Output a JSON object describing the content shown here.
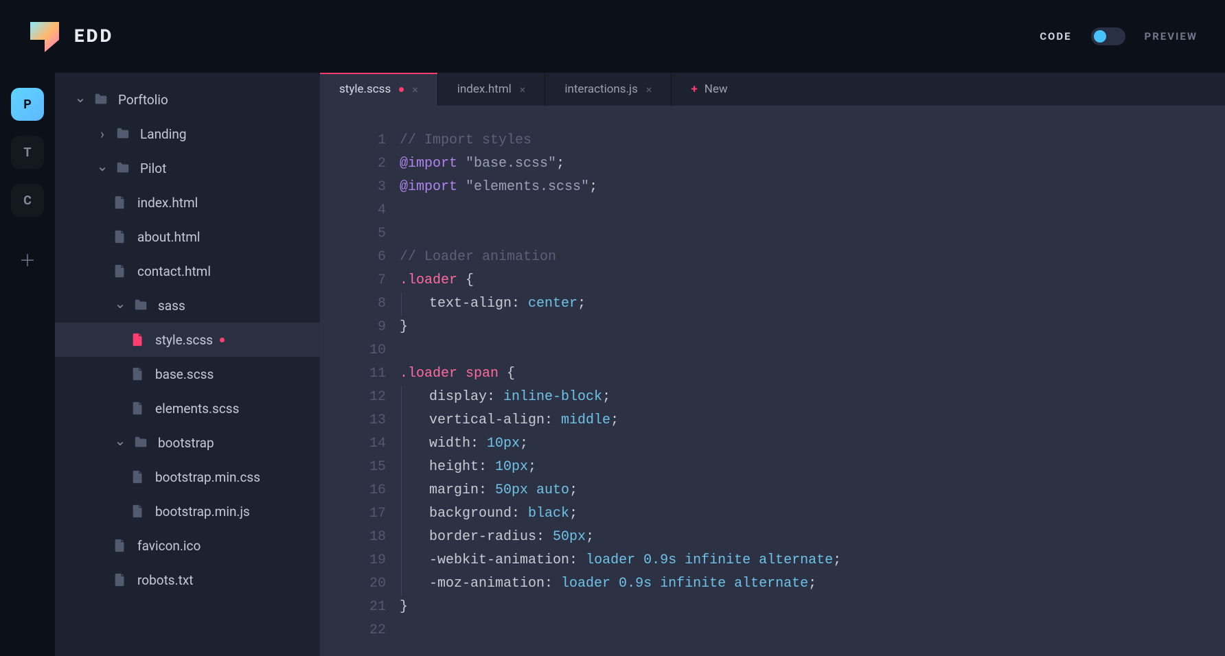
{
  "header": {
    "app_name": "EDD",
    "code_label": "CODE",
    "preview_label": "PREVIEW",
    "mode": "code"
  },
  "rail": {
    "items": [
      {
        "letter": "P",
        "active": true
      },
      {
        "letter": "T",
        "active": false
      },
      {
        "letter": "C",
        "active": false
      }
    ]
  },
  "sidebar": {
    "tree": [
      {
        "name": "Porftolio",
        "type": "folder",
        "level": 1,
        "expanded": true
      },
      {
        "name": "Landing",
        "type": "folder",
        "level": 2,
        "expanded": false
      },
      {
        "name": "Pilot",
        "type": "folder",
        "level": 2,
        "expanded": true
      },
      {
        "name": "index.html",
        "type": "file",
        "level": 3
      },
      {
        "name": "about.html",
        "type": "file",
        "level": 3
      },
      {
        "name": "contact.html",
        "type": "file",
        "level": 3
      },
      {
        "name": "sass",
        "type": "folder",
        "level": 3,
        "expanded": true
      },
      {
        "name": "style.scss",
        "type": "file",
        "level": 4,
        "active": true,
        "modified": true
      },
      {
        "name": "base.scss",
        "type": "file",
        "level": 4
      },
      {
        "name": "elements.scss",
        "type": "file",
        "level": 4
      },
      {
        "name": "bootstrap",
        "type": "folder",
        "level": 3,
        "expanded": true
      },
      {
        "name": "bootstrap.min.css",
        "type": "file",
        "level": 4
      },
      {
        "name": "bootstrap.min.js",
        "type": "file",
        "level": 4
      },
      {
        "name": "favicon.ico",
        "type": "file",
        "level": 3
      },
      {
        "name": "robots.txt",
        "type": "file",
        "level": 3
      }
    ]
  },
  "tabs": {
    "items": [
      {
        "label": "style.scss",
        "active": true,
        "modified": true
      },
      {
        "label": "index.html",
        "active": false
      },
      {
        "label": "interactions.js",
        "active": false
      }
    ],
    "new_label": "New"
  },
  "code": {
    "lines": [
      {
        "n": 1,
        "t": "comment",
        "text": "// Import styles"
      },
      {
        "n": 2,
        "t": "import",
        "kw": "@import",
        "str": "\"base.scss\""
      },
      {
        "n": 3,
        "t": "import",
        "kw": "@import",
        "str": "\"elements.scss\""
      },
      {
        "n": 4,
        "t": "blank"
      },
      {
        "n": 5,
        "t": "blank"
      },
      {
        "n": 6,
        "t": "comment",
        "text": "// Loader animation"
      },
      {
        "n": 7,
        "t": "selopen",
        "sel": ".loader"
      },
      {
        "n": 8,
        "t": "prop",
        "prop": "text-align",
        "val": "center"
      },
      {
        "n": 9,
        "t": "close"
      },
      {
        "n": 10,
        "t": "blank"
      },
      {
        "n": 11,
        "t": "selopen",
        "sel": ".loader span"
      },
      {
        "n": 12,
        "t": "prop",
        "prop": "display",
        "val": "inline-block"
      },
      {
        "n": 13,
        "t": "prop",
        "prop": "vertical-align",
        "val": "middle"
      },
      {
        "n": 14,
        "t": "prop",
        "prop": "width",
        "val": "10px"
      },
      {
        "n": 15,
        "t": "prop",
        "prop": "height",
        "val": "10px"
      },
      {
        "n": 16,
        "t": "prop",
        "prop": "margin",
        "val": "50px auto"
      },
      {
        "n": 17,
        "t": "prop",
        "prop": "background",
        "val": "black"
      },
      {
        "n": 18,
        "t": "prop",
        "prop": "border-radius",
        "val": "50px"
      },
      {
        "n": 19,
        "t": "prop",
        "prop": "-webkit-animation",
        "val": "loader 0.9s infinite alternate"
      },
      {
        "n": 20,
        "t": "prop",
        "prop": "-moz-animation",
        "val": "loader 0.9s infinite alternate"
      },
      {
        "n": 21,
        "t": "close"
      },
      {
        "n": 22,
        "t": "blank"
      }
    ]
  }
}
